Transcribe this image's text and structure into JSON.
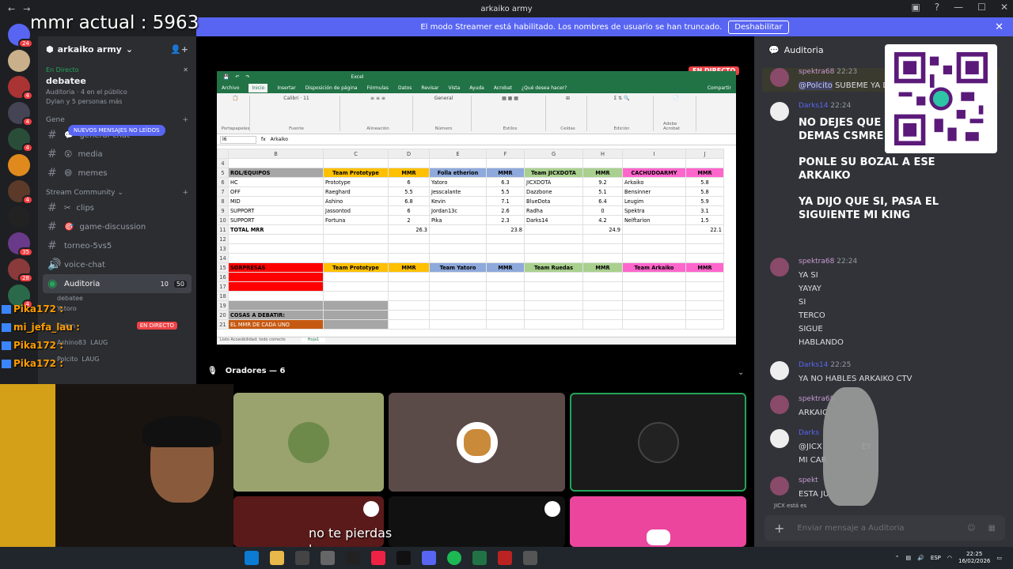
{
  "window": {
    "title": "arkaiko army"
  },
  "overlay": {
    "mmr_text": "mmr actual : 5963",
    "caption_line1": "no te pierdas",
    "caption_line2": "las sorpresas"
  },
  "banner": {
    "text": "El modo Streamer está habilitado. Los nombres de usuario se han truncado.",
    "button": "Deshabilitar"
  },
  "server_badges": [
    "24",
    "4",
    "4",
    "4",
    "4",
    "35",
    "28",
    "4"
  ],
  "server": {
    "name": "arkaiko army"
  },
  "live_event": {
    "status": "En Directo",
    "title": "debatee",
    "channel": "Auditoria",
    "public": "4 en el público",
    "people": "Dylan y 5 personas más"
  },
  "new_messages_pill": "NUEVOS MENSAJES NO LEÍDOS",
  "categories": {
    "general": "Gene",
    "stream": "Stream Community"
  },
  "channels": [
    {
      "name": "general-chat",
      "emoji": "💬"
    },
    {
      "name": "media",
      "emoji": "😲"
    },
    {
      "name": "memes",
      "emoji": "😄"
    }
  ],
  "stream_channels": [
    {
      "name": "clips",
      "emoji": "✂"
    },
    {
      "name": "game-discussion",
      "emoji": "🎯"
    },
    {
      "name": "torneo-5vs5",
      "emoji": ""
    },
    {
      "name": "voice-chat",
      "emoji": ""
    }
  ],
  "voice": {
    "name": "Auditoria",
    "count_cam": "10",
    "count_users": "50",
    "subtitle": "debatee",
    "users": [
      {
        "name": "Yatoro",
        "tag": ""
      },
      {
        "name": "Dylan",
        "tag": "EN DIRECTO"
      },
      {
        "name": "Ashino83",
        "tag": "LAUG"
      },
      {
        "name": "Polcito",
        "tag": "LAUG"
      }
    ]
  },
  "stream_chat": [
    {
      "name": "Pika172 :",
      "msg": ""
    },
    {
      "name": "mi_jefa_lau :",
      "msg": ""
    },
    {
      "name": "Pika172 :",
      "msg": ""
    },
    {
      "name": "Pika172 :",
      "msg": ""
    }
  ],
  "excel": {
    "live_badge": "EN DIRECTO",
    "title": "Excel",
    "tabs": [
      "Archivo",
      "Inicio",
      "Insertar",
      "Disposición de página",
      "Fórmulas",
      "Datos",
      "Revisar",
      "Vista",
      "Ayuda",
      "Acrobat",
      "¿Qué desea hacer?",
      "Compartir"
    ],
    "ribbon_groups": [
      "Portapapeles",
      "Fuente",
      "Alineación",
      "Número",
      "Estilos",
      "Celdas",
      "Edición",
      "Adobe Acrobat"
    ],
    "cell_ref": "I6",
    "formula": "Arkaiko",
    "columns": [
      "B",
      "C",
      "D",
      "E",
      "F",
      "G",
      "H",
      "I",
      "J"
    ],
    "header_row": [
      "ROL/EQUIPOS",
      "Team Prototype",
      "MMR",
      "Folla etherion",
      "MMR",
      "Team JICXDOTA",
      "MMR",
      "CACHUDOARMY",
      "MMR"
    ],
    "rows": [
      [
        "HC",
        "Prototype",
        "6",
        "Yatoro",
        "6.3",
        "JICXDOTA",
        "9.2",
        "Arkaiko",
        "5.8"
      ],
      [
        "OFF",
        "Raeghard",
        "5.5",
        "Jesscalante",
        "5.5",
        "Dazzbone",
        "5.1",
        "Bensinner",
        "5.8"
      ],
      [
        "MID",
        "Ashino",
        "6.8",
        "Kevin",
        "7.1",
        "BlueDota",
        "6.4",
        "Leugim",
        "5.9"
      ],
      [
        "SUPPORT",
        "Jassontod",
        "6",
        "Jordan13c",
        "2.6",
        "Radha",
        "0",
        "Spektra",
        "3.1"
      ],
      [
        "SUPPORT",
        "Fortuna",
        "2",
        "Pika",
        "2.3",
        "Darks14",
        "4.2",
        "Nelftarion",
        "1.5"
      ]
    ],
    "total_row": [
      "TOTAL MRR",
      "",
      "26.3",
      "",
      "23.8",
      "",
      "24.9",
      "",
      "22.1"
    ],
    "header2": [
      "SORPRESAS",
      "Team Prototype",
      "MMR",
      "Team Yatoro",
      "MMR",
      "Team Ruedas",
      "MMR",
      "Team Arkaiko",
      "MMR"
    ],
    "row20": "COSAS A DEBATIR:",
    "row21": "EL MMR DE CADA UNO",
    "sheet": "Hoja1",
    "status": "Listo   Accesibilidad: todo correcto"
  },
  "speakers": {
    "label": "Oradores — 6"
  },
  "right_panel": {
    "title": "Auditoria",
    "messages": [
      {
        "user": "spektra68",
        "time": "22:23",
        "reply": "@Polcito",
        "text": "SUBEME YA D"
      },
      {
        "user": "Darks14",
        "time": "22:24",
        "big": [
          "NO DEJES QUE",
          "DEMAS CSMRE",
          "PONLE SU BOZAL A ESE",
          "ARKAIKO",
          "YA DIJO QUE SI, PASA EL",
          "SIGUIENTE MI KING"
        ]
      },
      {
        "user": "spektra68",
        "time": "22:24",
        "lines": [
          "YA SI",
          "YAYAY",
          "SI",
          "TERCO",
          "SIGUE",
          "HABLANDO"
        ]
      },
      {
        "user": "Darks14",
        "time": "22:25",
        "text": "YA NO HABLES ARKAIKO CTV"
      },
      {
        "user": "spektra68",
        "time": "",
        "text": "ARKAIC"
      },
      {
        "user": "Darks",
        "time": "",
        "reply": "@JICX",
        "text2": "EY",
        "text": "MI CAR"
      },
      {
        "user": "spekt",
        "time": "",
        "text": "ESTA JU"
      }
    ],
    "typing": "JICX está es",
    "input_placeholder": "Enviar mensaje a Auditoria"
  },
  "taskbar": {
    "lang": "ESP",
    "time": "22:25",
    "date": "16/02/2026"
  }
}
